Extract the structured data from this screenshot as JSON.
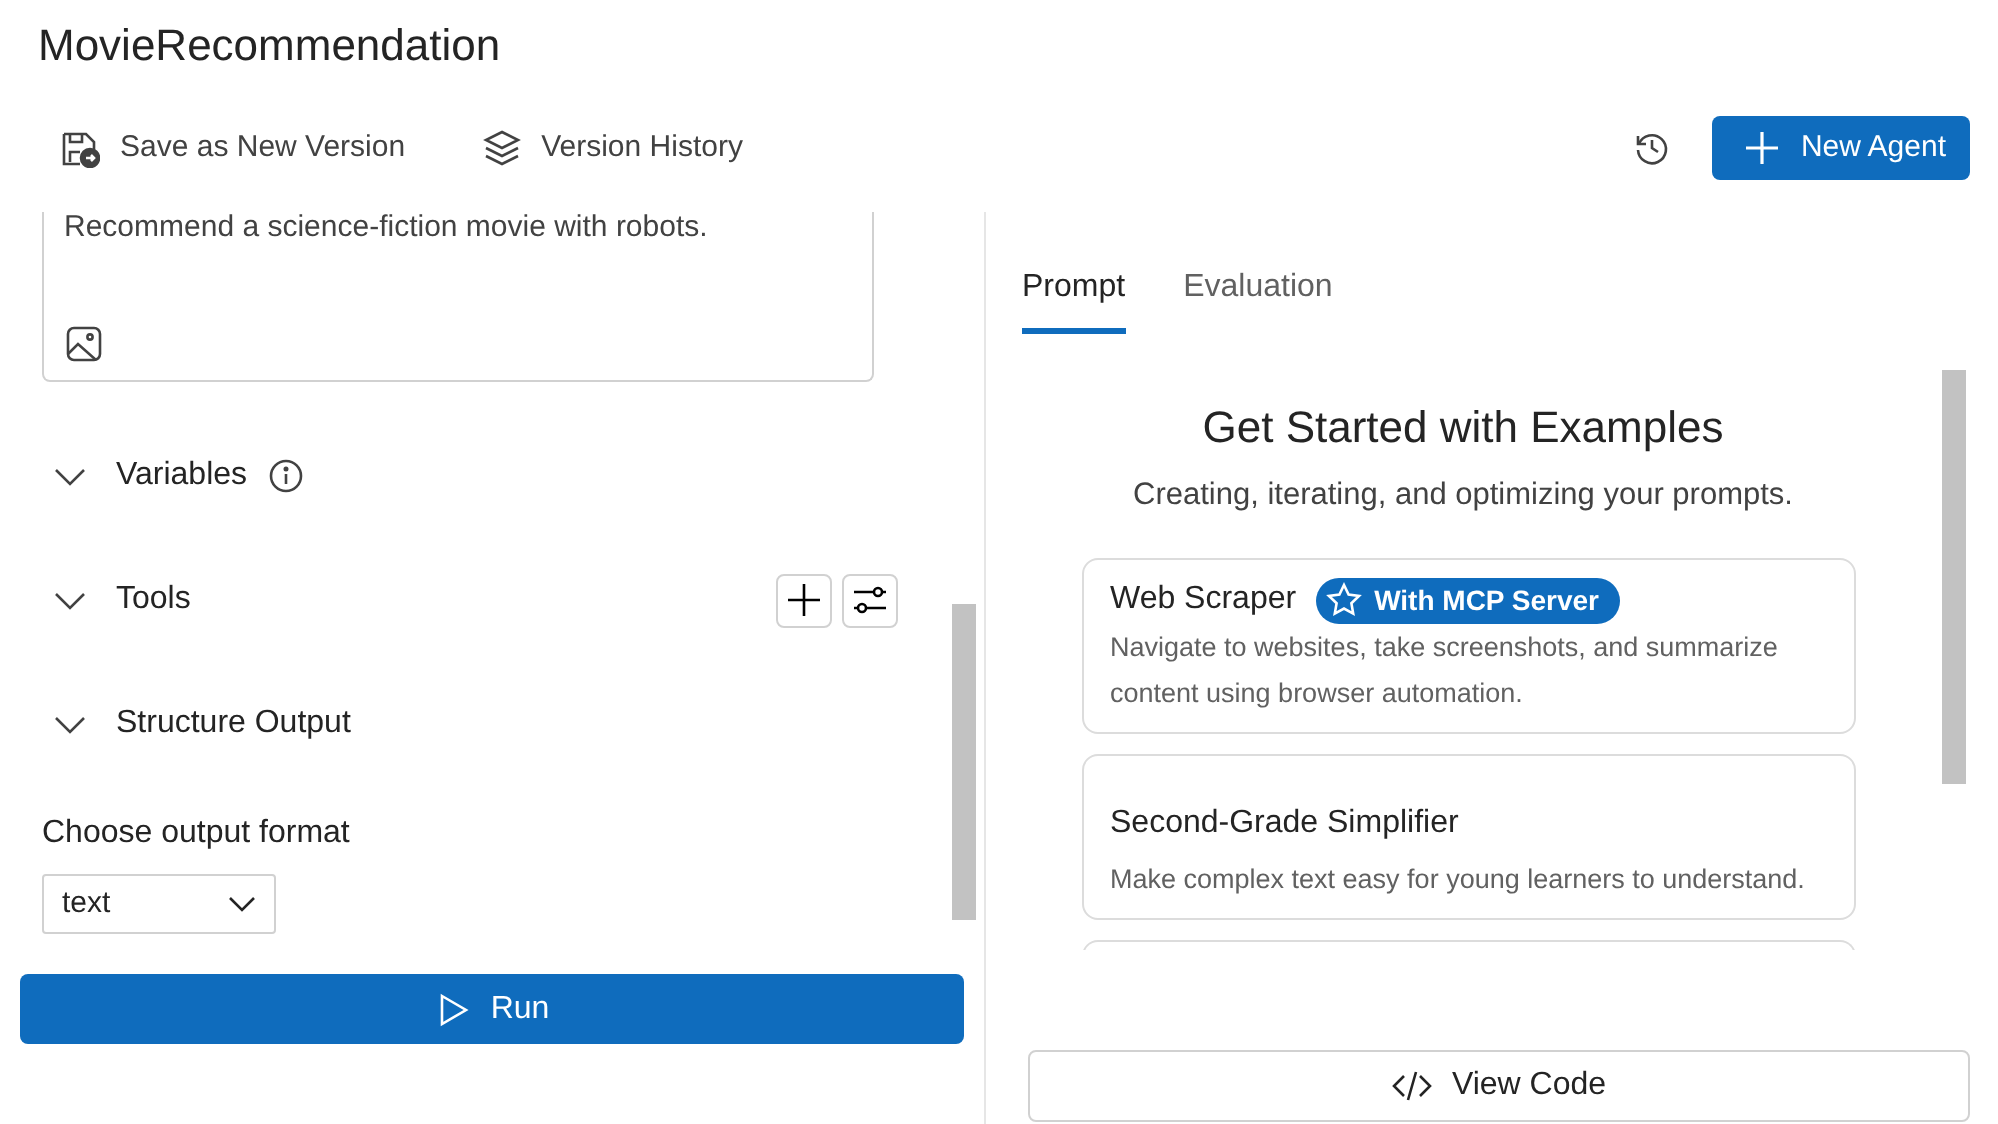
{
  "title": "MovieRecommendation",
  "toolbar": {
    "actions": [
      {
        "label": "Save as New Version",
        "kind": "save"
      },
      {
        "label": "Version History",
        "kind": "layers"
      }
    ],
    "new_agent": "New Agent"
  },
  "prompt": {
    "text": "Recommend a science-fiction movie with robots."
  },
  "sections": [
    {
      "label": "Variables",
      "kind": "info"
    },
    {
      "label": "Tools",
      "kind": "tools"
    },
    {
      "label": "Structure Output",
      "kind": "plain"
    }
  ],
  "output_format": {
    "label": "Choose output format",
    "value": "text"
  },
  "run_button": "Run",
  "tabs": [
    {
      "label": "Prompt",
      "selected": true
    },
    {
      "label": "Evaluation",
      "selected": false
    }
  ],
  "examples": {
    "heading": "Get Started with Examples",
    "subtitle": "Creating, iterating, and optimizing your prompts.",
    "cards": [
      {
        "title": "Web Scraper",
        "badge": "With MCP Server",
        "description": "Navigate to websites, take screenshots, and summarize content using browser automation."
      },
      {
        "title": "Second-Grade Simplifier",
        "description": "Make complex text easy for young learners to understand."
      }
    ]
  },
  "view_code_button": "View Code"
}
